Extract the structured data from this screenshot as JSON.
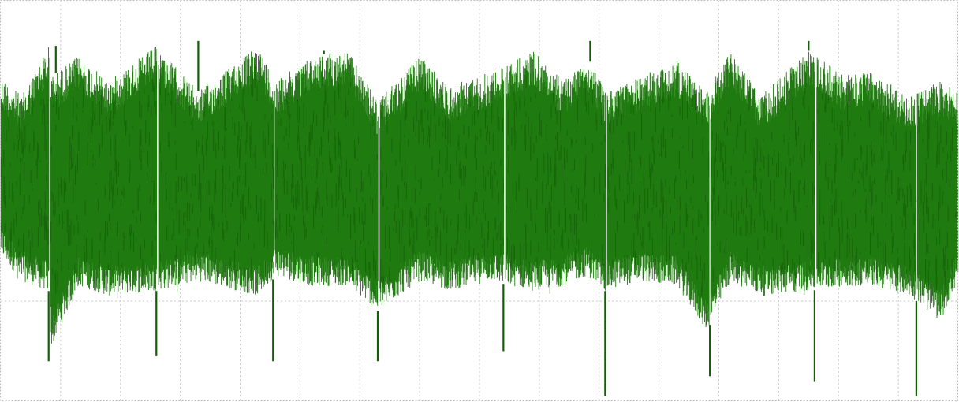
{
  "chart_data": {
    "type": "line",
    "title": "",
    "xlabel": "",
    "ylabel": "",
    "grid": true,
    "legend": "none",
    "xlim": [
      0,
      16
    ],
    "ylim": [
      -2,
      2
    ],
    "x_gridlines": [
      1,
      2,
      3,
      4,
      5,
      6,
      7,
      8,
      9,
      10,
      11,
      12,
      13,
      14,
      15
    ],
    "y_gridlines": [
      -1,
      0,
      1
    ],
    "series": [
      {
        "color": "#1f7a0f",
        "edge_color": "#145e08",
        "envelope": {
          "x": [
            0.0,
            0.35,
            0.8,
            0.85,
            1.3,
            1.8,
            2.6,
            3.3,
            4.3,
            4.6,
            5.2,
            5.8,
            6.3,
            7.0,
            7.5,
            8.2,
            8.9,
            9.4,
            9.8,
            10.1,
            10.7,
            11.3,
            11.8,
            12.2,
            12.7,
            13.5,
            14.1,
            14.5,
            15.2,
            15.7,
            16.0
          ],
          "upper": [
            1.25,
            1.05,
            1.55,
            1.25,
            1.45,
            1.2,
            1.55,
            1.1,
            1.55,
            1.2,
            1.45,
            1.5,
            1.0,
            1.45,
            1.15,
            1.3,
            1.5,
            1.2,
            1.45,
            1.1,
            1.25,
            1.4,
            1.1,
            1.5,
            1.05,
            1.5,
            1.25,
            1.3,
            1.05,
            1.2,
            1.1
          ],
          "lower": [
            -0.55,
            -0.8,
            -0.9,
            -1.45,
            -0.85,
            -0.95,
            -0.9,
            -0.8,
            -0.95,
            -0.75,
            -0.85,
            -0.85,
            -1.1,
            -0.8,
            -0.9,
            -0.8,
            -0.9,
            -0.85,
            -0.75,
            -0.9,
            -0.8,
            -0.85,
            -1.3,
            -0.8,
            -0.95,
            -0.9,
            -0.85,
            -0.85,
            -0.95,
            -1.2,
            -0.8
          ]
        },
        "spikes_down": [
          {
            "x": 0.8,
            "y": -1.6
          },
          {
            "x": 2.6,
            "y": -1.55
          },
          {
            "x": 4.55,
            "y": -1.6
          },
          {
            "x": 6.3,
            "y": -1.6
          },
          {
            "x": 8.4,
            "y": -1.5
          },
          {
            "x": 10.1,
            "y": -1.95
          },
          {
            "x": 11.85,
            "y": -1.75
          },
          {
            "x": 13.6,
            "y": -1.8
          },
          {
            "x": 15.3,
            "y": -1.95
          }
        ],
        "spikes_up": [
          {
            "x": 0.92,
            "y": 1.55
          },
          {
            "x": 3.3,
            "y": 1.6
          },
          {
            "x": 5.4,
            "y": 1.5
          },
          {
            "x": 9.85,
            "y": 1.6
          },
          {
            "x": 13.5,
            "y": 1.6
          }
        ],
        "gaps": [
          0.82,
          2.62,
          4.57,
          6.32,
          8.42,
          10.12,
          11.85,
          13.62,
          15.3
        ]
      }
    ]
  }
}
